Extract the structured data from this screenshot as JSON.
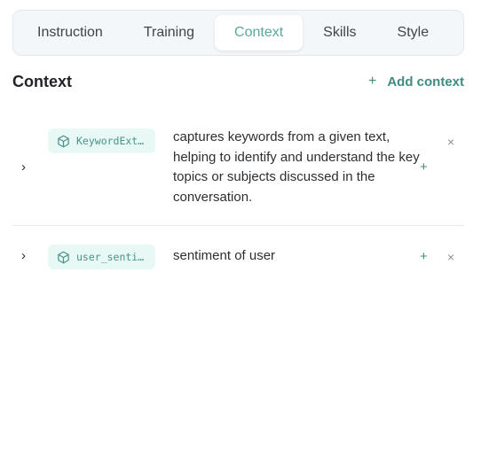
{
  "tabs": [
    "Instruction",
    "Training",
    "Context",
    "Skills",
    "Style"
  ],
  "active_tab": "Context",
  "section": {
    "title": "Context",
    "add_label": "Add context",
    "add_icon": "+"
  },
  "rows": [
    {
      "chip_label": "KeywordExt…",
      "description": "captures keywords from a given text, helping to identify and understand the key topics or subjects discussed in the conversation.",
      "expand_icon": "›",
      "add_icon": "+",
      "remove_icon": "×"
    },
    {
      "chip_label": "user_senti…",
      "description": "sentiment of user",
      "expand_icon": "›",
      "add_icon": "+",
      "remove_icon": "×"
    }
  ],
  "colors": {
    "accent": "#3f8c80",
    "chip_bg": "#e8f8f5",
    "active_tab_text": "#5aa89a"
  }
}
